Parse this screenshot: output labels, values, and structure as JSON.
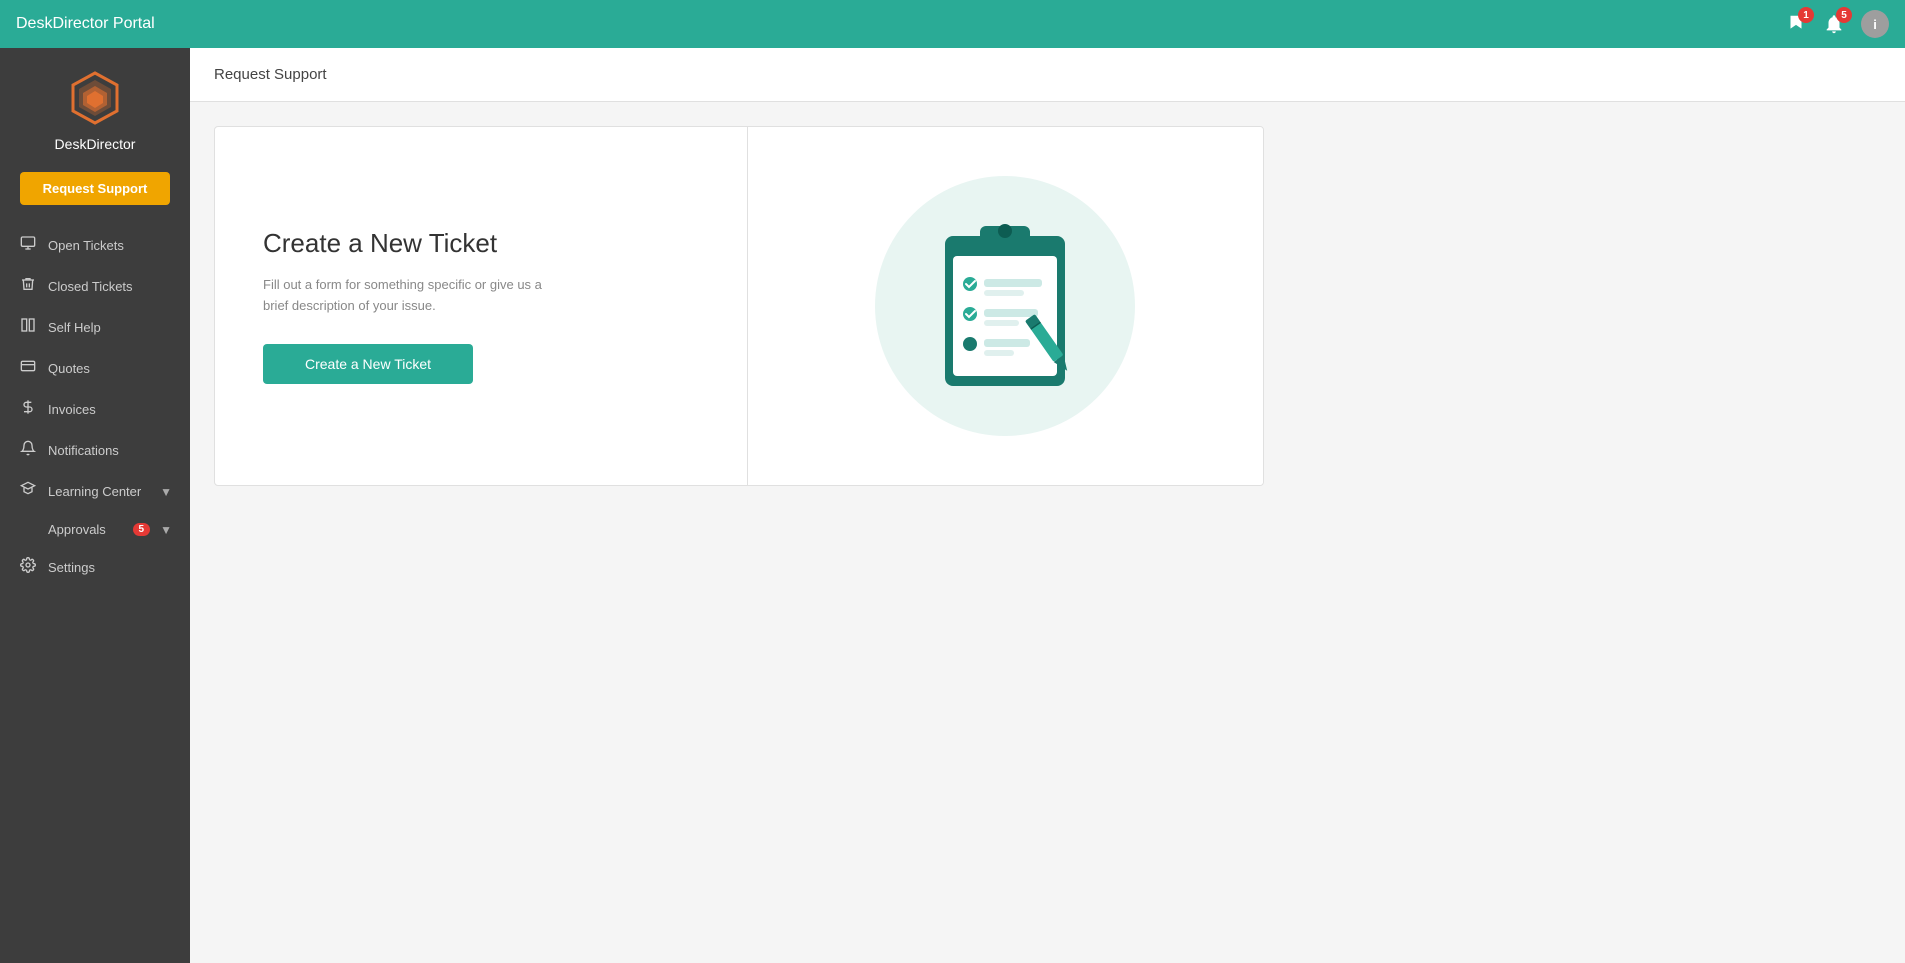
{
  "topbar": {
    "title": "DeskDirector Portal",
    "messages_badge": "1",
    "notifications_badge": "5"
  },
  "sidebar": {
    "brand": "DeskDirector",
    "request_support_label": "Request Support",
    "nav_items": [
      {
        "id": "open-tickets",
        "icon": "monitor",
        "label": "Open Tickets",
        "badge": null
      },
      {
        "id": "closed-tickets",
        "icon": "trash",
        "label": "Closed Tickets",
        "badge": null
      },
      {
        "id": "self-help",
        "icon": "book",
        "label": "Self Help",
        "badge": null
      },
      {
        "id": "quotes",
        "icon": "card",
        "label": "Quotes",
        "badge": null
      },
      {
        "id": "invoices",
        "icon": "dollar",
        "label": "Invoices",
        "badge": null
      },
      {
        "id": "notifications",
        "icon": "bell",
        "label": "Notifications",
        "badge": null
      },
      {
        "id": "learning-center",
        "icon": "hat",
        "label": "Learning Center",
        "badge": null,
        "chevron": true
      },
      {
        "id": "approvals",
        "icon": null,
        "label": "Approvals",
        "badge": "5",
        "chevron": true
      },
      {
        "id": "settings",
        "icon": "gear",
        "label": "Settings",
        "badge": null
      }
    ]
  },
  "page": {
    "header": "Request Support",
    "card": {
      "title": "Create a New Ticket",
      "description": "Fill out a form for something specific or give us a brief description of your issue.",
      "button_label": "Create a New Ticket"
    }
  }
}
